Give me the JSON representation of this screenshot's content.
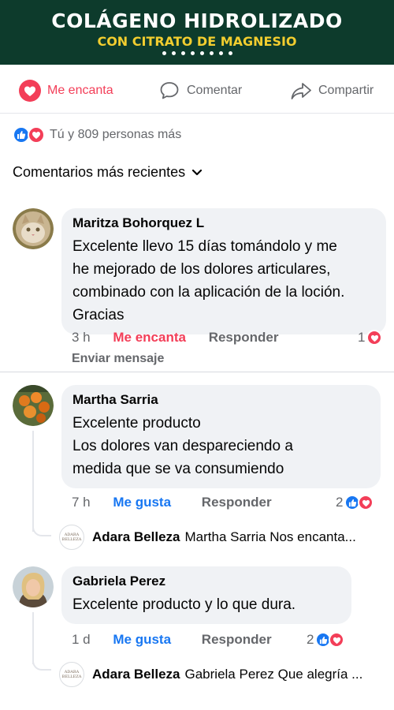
{
  "banner": {
    "title": "COLÁGENO HIDROLIZADO",
    "subtitle": "CON CITRATO DE MAGNESIO",
    "title_color": "#ffffff",
    "subtitle_color": "#f2cd2f",
    "background": "#0d3b2c"
  },
  "actions": {
    "love_label": "Me encanta",
    "comment_label": "Comentar",
    "share_label": "Compartir"
  },
  "reactions": {
    "summary": "Tú y 809 personas más"
  },
  "comments_filter": "Comentarios más recientes",
  "comments": [
    {
      "author": "Maritza Bohorquez L",
      "text": "Excelente llevo 15 días tomándolo y me\nhe mejorado de los dolores articulares,\ncombinado con la aplicación de la loción.\nGracias",
      "time": "3 h",
      "reaction_label": "Me encanta",
      "reply_label": "Responder",
      "count": "1",
      "extra_action": "Enviar mensaje"
    },
    {
      "author": "Martha Sarria",
      "text": "Excelente producto\nLos dolores van despareciendo a\nmedida que se va consumiendo",
      "time": "7 h",
      "reaction_label": "Me gusta",
      "reply_label": "Responder",
      "count": "2",
      "reply": {
        "author": "Adara Belleza",
        "text": "Martha Sarria Nos encanta..."
      }
    },
    {
      "author": "Gabriela Perez",
      "text": "Excelente producto y lo que dura.",
      "time": "1 d",
      "reaction_label": "Me gusta",
      "reply_label": "Responder",
      "count": "2",
      "reply": {
        "author": "Adara Belleza",
        "text": "Gabriela Perez Que alegría ..."
      }
    }
  ],
  "colors": {
    "love": "#f33e58",
    "like": "#1877f2",
    "muted": "#65676b",
    "bubble": "#f0f2f5"
  }
}
